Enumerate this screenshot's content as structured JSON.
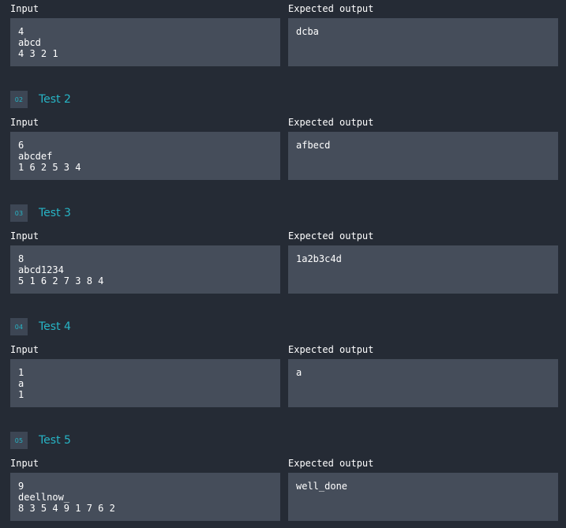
{
  "labels": {
    "input": "Input",
    "expected_output": "Expected output"
  },
  "tests": [
    {
      "number": "",
      "title": "",
      "input": "4\nabcd\n4 3 2 1",
      "expected": "dcba"
    },
    {
      "number": "02",
      "title": "Test 2",
      "input": "6\nabcdef\n1 6 2 5 3 4",
      "expected": "afbecd"
    },
    {
      "number": "03",
      "title": "Test 3",
      "input": "8\nabcd1234\n5 1 6 2 7 3 8 4",
      "expected": "1a2b3c4d"
    },
    {
      "number": "04",
      "title": "Test 4",
      "input": "1\na\n1",
      "expected": "a"
    },
    {
      "number": "05",
      "title": "Test 5",
      "input": "9\ndeellnow_\n8 3 5 4 9 1 7 6 2",
      "expected": "well_done"
    }
  ],
  "colors": {
    "background": "#252b35",
    "box": "#454d5a",
    "accent": "#27b5c6",
    "badge": "#3d4654"
  }
}
